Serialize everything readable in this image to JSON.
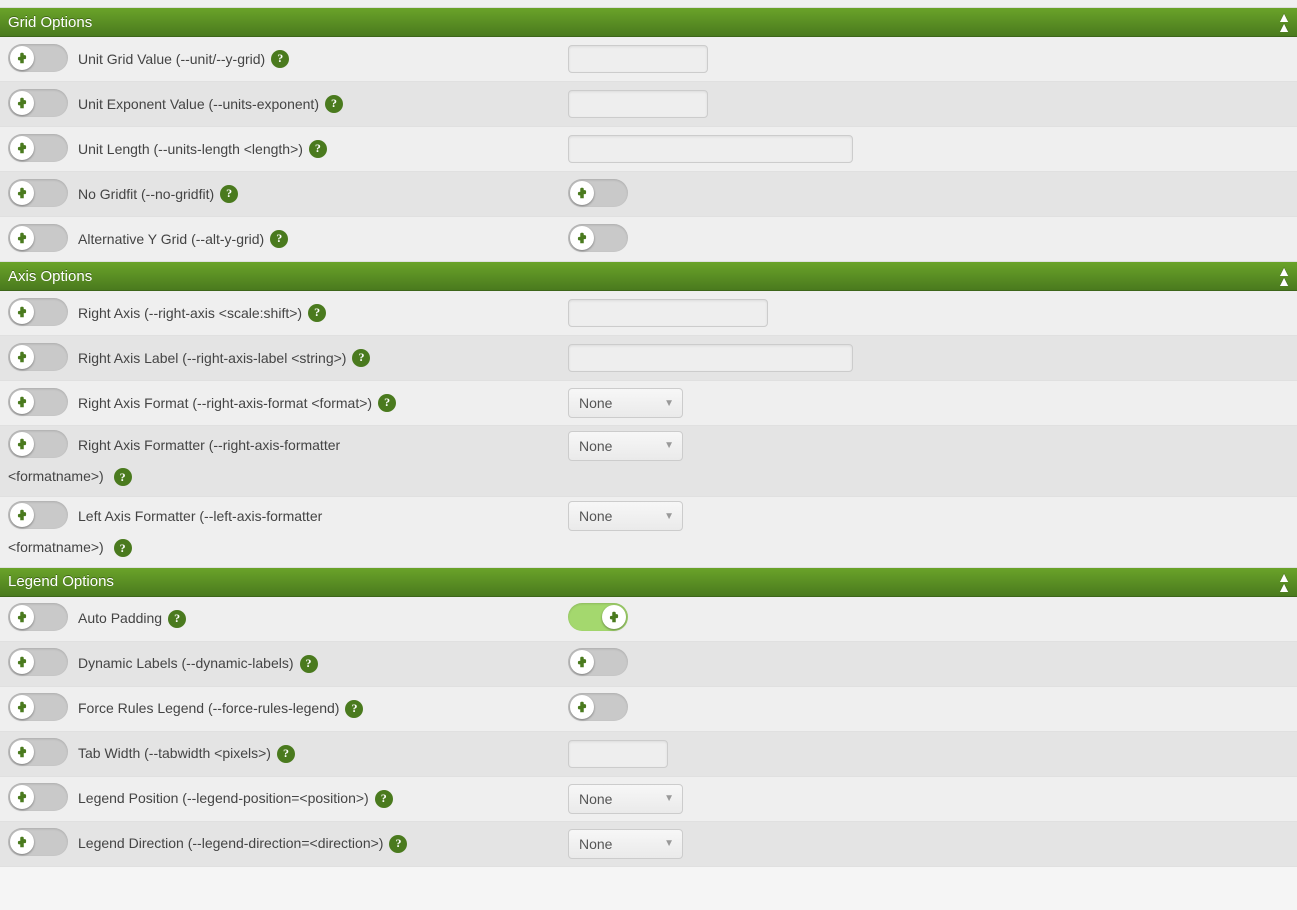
{
  "sections": {
    "grid": {
      "title": "Grid Options",
      "rows": {
        "unit_grid": {
          "label": "Unit Grid Value (--unit/--y-grid)",
          "value": ""
        },
        "unit_exp": {
          "label": "Unit Exponent Value (--units-exponent)",
          "value": ""
        },
        "unit_len": {
          "label": "Unit Length (--units-length <length>)",
          "value": ""
        },
        "no_gridfit": {
          "label": "No Gridfit (--no-gridfit)"
        },
        "alt_y_grid": {
          "label": "Alternative Y Grid (--alt-y-grid)"
        }
      }
    },
    "axis": {
      "title": "Axis Options",
      "rows": {
        "right_axis": {
          "label": "Right Axis (--right-axis <scale:shift>)",
          "value": ""
        },
        "right_axis_label": {
          "label": "Right Axis Label (--right-axis-label <string>)",
          "value": ""
        },
        "right_axis_fmt": {
          "label": "Right Axis Format (--right-axis-format <format>)",
          "select": "None"
        },
        "right_axis_ftr": {
          "label": "Right Axis Formatter (--right-axis-formatter",
          "wrap": "<formatname>)",
          "select": "None"
        },
        "left_axis_ftr": {
          "label": "Left Axis Formatter (--left-axis-formatter",
          "wrap": "<formatname>)",
          "select": "None"
        }
      }
    },
    "legend": {
      "title": "Legend Options",
      "rows": {
        "auto_pad": {
          "label": "Auto Padding"
        },
        "dyn_labels": {
          "label": "Dynamic Labels (--dynamic-labels)"
        },
        "force_rules": {
          "label": "Force Rules Legend (--force-rules-legend)"
        },
        "tab_width": {
          "label": "Tab Width (--tabwidth <pixels>)",
          "value": ""
        },
        "legend_pos": {
          "label": "Legend Position (--legend-position=<position>)",
          "select": "None"
        },
        "legend_dir": {
          "label": "Legend Direction (--legend-direction=<direction>)",
          "select": "None"
        }
      }
    }
  },
  "ui": {
    "help_glyph": "?",
    "select_none": "None"
  }
}
